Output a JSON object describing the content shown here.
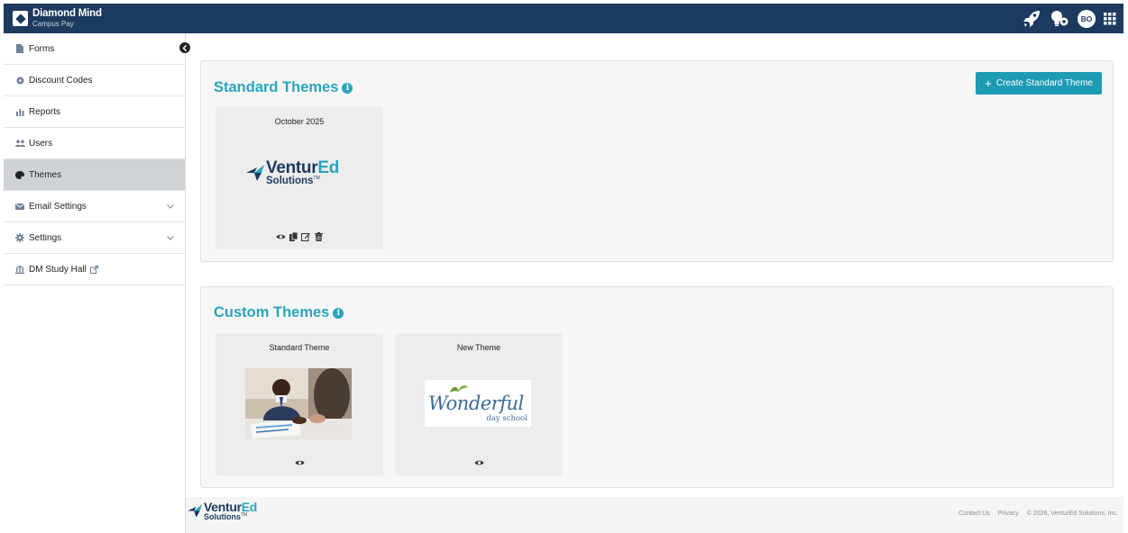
{
  "header": {
    "brand_name": "Diamond Mind",
    "brand_sub": "Campus Pay",
    "avatar_initials": "BO",
    "icons": [
      "rocket-icon",
      "settings-bulb-icon",
      "avatar",
      "app-grid-icon"
    ]
  },
  "sidebar": {
    "items": [
      {
        "label": "Forms",
        "icon": "document-icon"
      },
      {
        "label": "Discount Codes",
        "icon": "tag-icon"
      },
      {
        "label": "Reports",
        "icon": "bar-chart-icon"
      },
      {
        "label": "Users",
        "icon": "users-icon"
      },
      {
        "label": "Themes",
        "icon": "palette-icon",
        "active": true
      },
      {
        "label": "Email Settings",
        "icon": "envelope-icon",
        "expandable": true
      },
      {
        "label": "Settings",
        "icon": "gear-icon",
        "expandable": true
      },
      {
        "label": "DM Study Hall",
        "icon": "institution-icon",
        "external": true
      }
    ]
  },
  "standard_themes": {
    "title": "Standard Themes",
    "create_label": "Create Standard Theme",
    "cards": [
      {
        "title": "October 2025",
        "logo_text_a": "Ventur",
        "logo_text_b": "Ed",
        "logo_sub": "Solutions",
        "logo_tm": "TM"
      }
    ]
  },
  "custom_themes": {
    "title": "Custom Themes",
    "cards": [
      {
        "title": "Standard Theme"
      },
      {
        "title": "New Theme",
        "logo_main": "Wonderful",
        "logo_sub": "day school"
      }
    ]
  },
  "footer": {
    "logo_text_a": "Ventur",
    "logo_text_b": "Ed",
    "logo_sub": "Solutions",
    "logo_tm": "TM",
    "links": [
      "Contact Us",
      "Privacy"
    ],
    "copyright": "© 2026, VenturEd Solutions, Inc."
  },
  "colors": {
    "accent": "#2aa4bd",
    "navy": "#1c3a5f",
    "button": "#1e9bb4"
  }
}
